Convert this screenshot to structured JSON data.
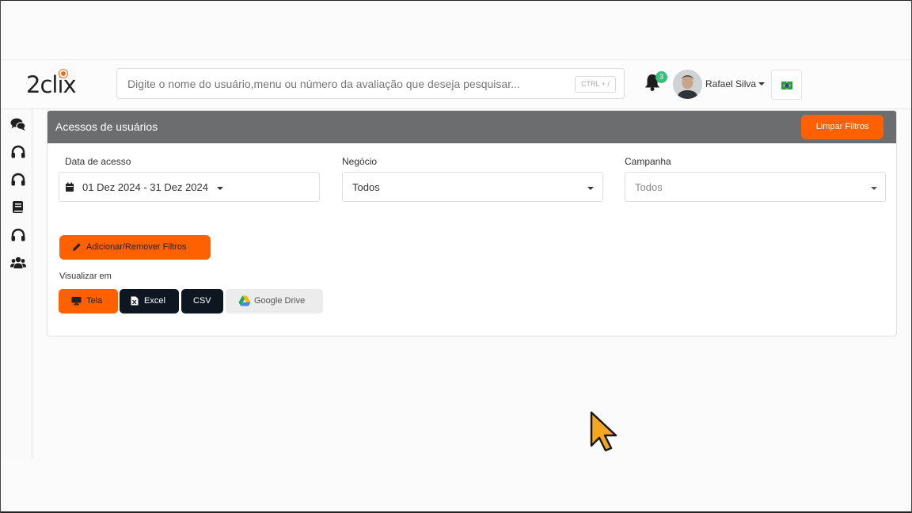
{
  "brand": {
    "logo_text": "2clix",
    "accent": "#ff6100"
  },
  "search": {
    "placeholder": "Digite o nome do usuário,menu ou número da avaliação que deseja pesquisar...",
    "shortcut": "CTRL + /"
  },
  "header": {
    "notifications_count": "3",
    "user_name": "Rafael Silva",
    "language_flag": "brazil-flag-icon"
  },
  "sidebar": {
    "items": [
      {
        "icon": "chat-icon"
      },
      {
        "icon": "headset-icon"
      },
      {
        "icon": "headset-icon"
      },
      {
        "icon": "book-icon"
      },
      {
        "icon": "headset-icon"
      },
      {
        "icon": "users-icon"
      }
    ]
  },
  "panel": {
    "title": "Acessos de usuários",
    "clear_filters_label": "Limpar Filtros",
    "filters": {
      "date_label": "Data de acesso",
      "date_value": "01 Dez 2024 - 31 Dez 2024",
      "business_label": "Negócio",
      "business_value": "Todos",
      "campaign_label": "Campanha",
      "campaign_value": "Todos"
    },
    "add_remove_filters_label": "Adicionar/Remover Filtros",
    "view_in_label": "Visualizar em",
    "view_buttons": {
      "screen": "Tela",
      "excel": "Excel",
      "csv": "CSV",
      "drive": "Google Drive"
    }
  }
}
